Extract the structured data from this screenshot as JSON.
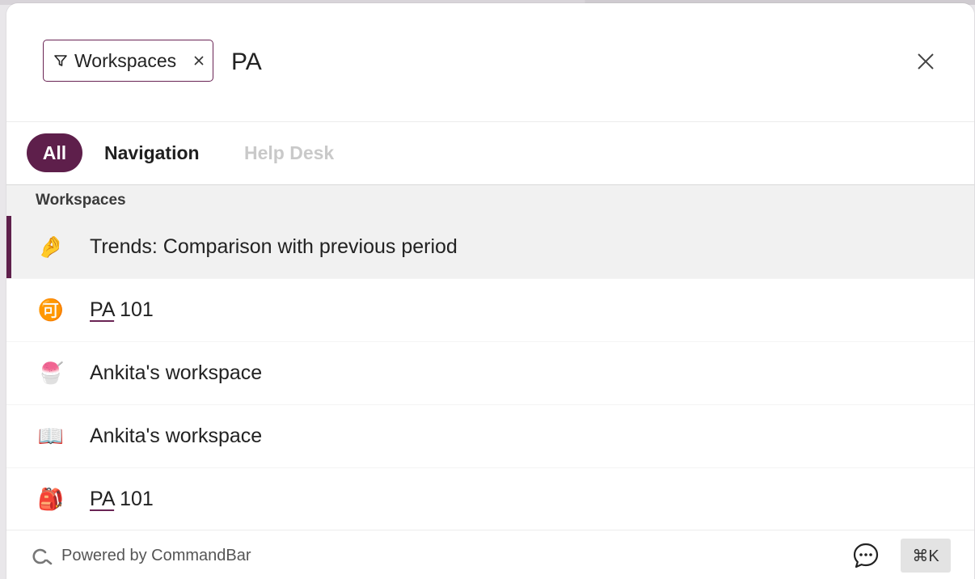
{
  "search": {
    "filter_chip_label": "Workspaces",
    "query": "PA"
  },
  "tabs": [
    {
      "label": "All",
      "active": true
    },
    {
      "label": "Navigation",
      "active": false
    },
    {
      "label": "Help Desk",
      "active": false
    }
  ],
  "section": {
    "title": "Workspaces"
  },
  "results": [
    {
      "icon": "🤌",
      "icon_name": "pinched-fingers-icon",
      "match": "",
      "label": "Trends: Comparison with previous period",
      "active": true
    },
    {
      "icon": "🉑",
      "icon_name": "accept-kanji-icon",
      "match": "PA",
      "label": " 101",
      "active": false
    },
    {
      "icon": "🍧",
      "icon_name": "shaved-ice-icon",
      "match": "",
      "label": "Ankita's workspace",
      "active": false
    },
    {
      "icon": "📖",
      "icon_name": "open-book-icon",
      "match": "",
      "label": "Ankita's workspace",
      "active": false
    },
    {
      "icon": "🎒",
      "icon_name": "backpack-icon",
      "match": "PA",
      "label": " 101",
      "active": false
    }
  ],
  "footer": {
    "powered_by": "Powered by CommandBar",
    "shortcut": "⌘K"
  },
  "colors": {
    "accent": "#5e1f4b",
    "active_row_bg": "#f1f1f1",
    "inactive_tab_text": "#c9c9c9"
  }
}
